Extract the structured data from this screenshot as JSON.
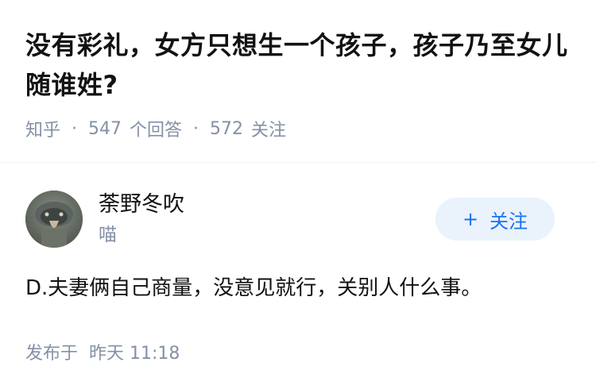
{
  "question": {
    "title": "没有彩礼，女方只想生一个孩子，孩子乃至女儿随谁姓?",
    "source": "知乎",
    "answers_count": "547",
    "answers_label": "个回答",
    "followers_count": "572",
    "followers_label": "关注"
  },
  "answer": {
    "author_name": "荼野冬吹",
    "author_bio": "喵",
    "follow_label": "关注",
    "follow_icon": "plus-icon",
    "content": "D.夫妻俩自己商量，没意见就行，关别人什么事。",
    "publish_label": "发布于",
    "publish_time": "昨天 11:18"
  },
  "colors": {
    "accent": "#1772f6",
    "follow_bg": "#eaf2fb",
    "meta_gray": "#8590a6",
    "text": "#121212"
  }
}
